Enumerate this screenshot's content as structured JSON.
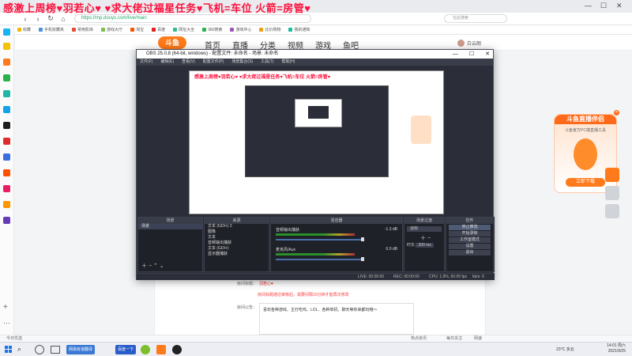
{
  "overlay": {
    "marquee": "感激上周榜♥羽若心♥ ♥求大佬过福星任务♥飞机=车位  火箭=房管♥",
    "marquee_small": "感激上周榜♥羽若心♥ ♥求大佬过福星任务♥飞机=车位  火箭=房管♥"
  },
  "browser": {
    "tab_title": "个人中...",
    "url": "https://mp.douyu.com/live/main",
    "search_placeholder": "在此搜索",
    "search_hint": "斗鱼",
    "win_controls": [
      "—",
      "☐",
      "✕"
    ],
    "nav": [
      "‹",
      "›",
      "↻",
      "⌂"
    ],
    "bookmarks": [
      "收藏",
      "手机收藏夹",
      "常用影库",
      "游戏大厅",
      "淘宝",
      "百度",
      "网址大全",
      "360搜索",
      "游戏中心",
      "比价购物",
      "我的通知"
    ],
    "user": "白云朗"
  },
  "site": {
    "logo_text": "斗鱼",
    "nav": [
      "首页",
      "直播",
      "分类",
      "视频",
      "游戏",
      "鱼吧"
    ],
    "content_label_1": "房间标题：",
    "content_title": "羽若心♥",
    "content_note": "房间标题通过审核后，需要间隔10分钟才能再次修改",
    "content_label_2": "房间公告：",
    "announcement": "喜欢各种游戏、主打吃鸡、LOL、各种单机、聊天等你来都玩哦～",
    "right_panel_title": "斗鱼直播伴侣",
    "right_panel_sub": "斗鱼官方PC端直播工具",
    "right_panel_btn": "立即下载"
  },
  "obs": {
    "title": "OBS 25.0.8 (64-bit, windows) - 配置文件: 未命名 - 场景: 未命名",
    "menu": [
      "文件(F)",
      "编辑(E)",
      "查看(V)",
      "配置文件(P)",
      "场景集合(S)",
      "工具(T)",
      "帮助(H)"
    ],
    "docks": {
      "scenes": {
        "title": "场景",
        "items": [
          "场景"
        ]
      },
      "sources": {
        "title": "来源",
        "items": [
          "文本 (GDI+) 2",
          "图像",
          "文本",
          "音频输出捕获",
          "文本 (GDI+)",
          "显示器捕获"
        ]
      },
      "mixer": {
        "title": "混音器",
        "channels": [
          {
            "name": "音频输出捕获",
            "db": "-1.3 dB"
          },
          {
            "name": "麦克风/Aux",
            "db": "0.0 dB"
          }
        ]
      },
      "transitions": {
        "title": "场景过渡",
        "type": "淡出",
        "duration_label": "时长",
        "duration": "300 ms"
      },
      "controls": {
        "title": "控件",
        "buttons": [
          "停止推流",
          "开始录制",
          "工作室模式",
          "设置",
          "退出"
        ]
      }
    },
    "status": {
      "live": "LIVE: 00:00:00",
      "rec": "REC: 00:00:00",
      "cpu": "CPU: 1.9%, 60.00 fps",
      "kbps": "kb/s: 0"
    }
  },
  "statusline": {
    "left": "今日优选",
    "items": [
      "热点资讯",
      "每日关注",
      "网速"
    ]
  },
  "taskbar": {
    "apps": [
      "网易有道翻译",
      "百度一下"
    ],
    "tray_weather": "23°C 多云",
    "clock_time": "14:01 周六",
    "clock_date": "2021/9/25"
  },
  "colors": {
    "overlay_red": "#ff0f3c",
    "douyu_orange": "#ff7a1a",
    "obs_bg": "#2b2e38"
  }
}
